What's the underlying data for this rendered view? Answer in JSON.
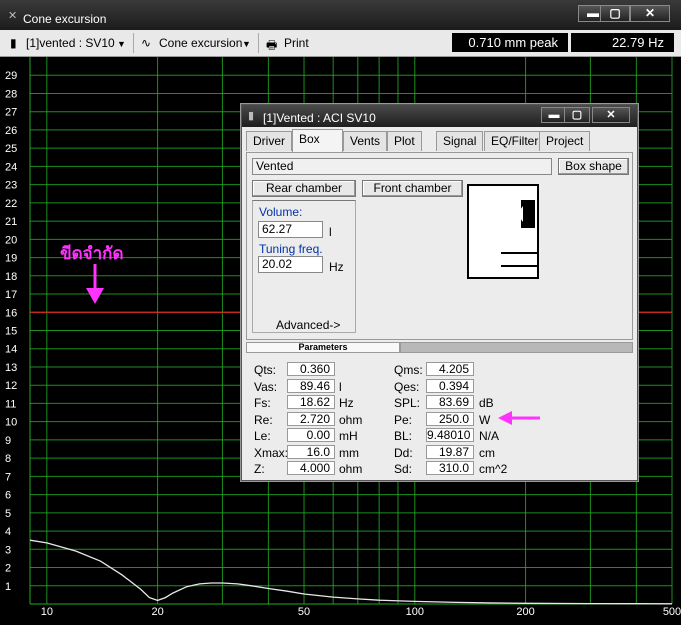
{
  "window": {
    "title": "Cone excursion",
    "app_icon": "app-icon"
  },
  "window_buttons": {
    "minimize": "▬",
    "maximize": "▢",
    "close": "✕"
  },
  "toolbar": {
    "project": "[1]vented : SV10",
    "view": "Cone excursion",
    "print": "Print",
    "peak_readout": "0.710 mm peak",
    "freq_readout": "22.79 Hz"
  },
  "annotation": {
    "text": "ขีดจำกัด"
  },
  "dialog": {
    "title": "[1]Vented : ACI SV10",
    "tabs": [
      "Driver",
      "Box",
      "Vents",
      "Plot",
      "Signal",
      "EQ/Filter",
      "Project"
    ],
    "active_tab": "Box",
    "box_type": "Vented",
    "box_shape_button": "Box shape",
    "rear_chamber_button": "Rear chamber",
    "front_chamber_button": "Front chamber",
    "volume_label": "Volume:",
    "volume_value": "62.27",
    "volume_unit": "l",
    "tuning_label": "Tuning freq.",
    "tuning_value": "20.02",
    "tuning_unit": "Hz",
    "advanced_button": "Advanced->",
    "parameters_header": "Parameters",
    "params_left": [
      {
        "name": "Qts:",
        "value": "0.360",
        "unit": ""
      },
      {
        "name": "Vas:",
        "value": "89.46",
        "unit": "l"
      },
      {
        "name": "Fs:",
        "value": "18.62",
        "unit": "Hz"
      },
      {
        "name": "Re:",
        "value": "2.720",
        "unit": "ohm"
      },
      {
        "name": "Le:",
        "value": "0.00",
        "unit": "mH"
      },
      {
        "name": "Xmax:",
        "value": "16.0",
        "unit": "mm"
      },
      {
        "name": "Z:",
        "value": "4.000",
        "unit": "ohm"
      }
    ],
    "params_right": [
      {
        "name": "Qms:",
        "value": "4.205",
        "unit": ""
      },
      {
        "name": "Qes:",
        "value": "0.394",
        "unit": ""
      },
      {
        "name": "SPL:",
        "value": "83.69",
        "unit": "dB"
      },
      {
        "name": "Pe:",
        "value": "250.0",
        "unit": "W"
      },
      {
        "name": "BL:",
        "value": "9.48010",
        "unit": "N/A"
      },
      {
        "name": "Dd:",
        "value": "19.87",
        "unit": "cm"
      },
      {
        "name": "Sd:",
        "value": "310.0",
        "unit": "cm^2"
      }
    ]
  },
  "colors": {
    "grid": "#22aa22",
    "limit_line": "#ff2222",
    "curve": "#e8e8e8",
    "annotation": "#ff33ff"
  },
  "chart_data": {
    "type": "line",
    "xscale": "log",
    "xlim": [
      9,
      500
    ],
    "ylim": [
      0,
      30
    ],
    "x_ticks": [
      "10",
      "20",
      "50",
      "100",
      "200",
      "500"
    ],
    "y_ticks": [
      "1",
      "2",
      "3",
      "4",
      "5",
      "6",
      "7",
      "8",
      "9",
      "10",
      "11",
      "12",
      "13",
      "14",
      "15",
      "16",
      "17",
      "18",
      "19",
      "20",
      "21",
      "22",
      "23",
      "24",
      "25",
      "26",
      "27",
      "28",
      "29"
    ],
    "limit_line": 16.0,
    "series": [
      {
        "x": [
          9,
          10,
          12,
          14,
          16,
          18,
          19,
          20,
          21,
          22,
          24,
          26,
          28,
          30,
          33,
          36,
          40,
          45,
          50,
          60,
          70,
          80,
          100,
          130,
          160,
          200,
          300,
          500
        ],
        "y": [
          3.5,
          3.35,
          2.9,
          2.35,
          1.6,
          0.8,
          0.35,
          0.2,
          0.35,
          0.6,
          0.95,
          1.1,
          1.15,
          1.15,
          1.1,
          1.0,
          0.85,
          0.7,
          0.55,
          0.38,
          0.28,
          0.21,
          0.14,
          0.09,
          0.06,
          0.04,
          0.02,
          0.01
        ]
      }
    ]
  }
}
